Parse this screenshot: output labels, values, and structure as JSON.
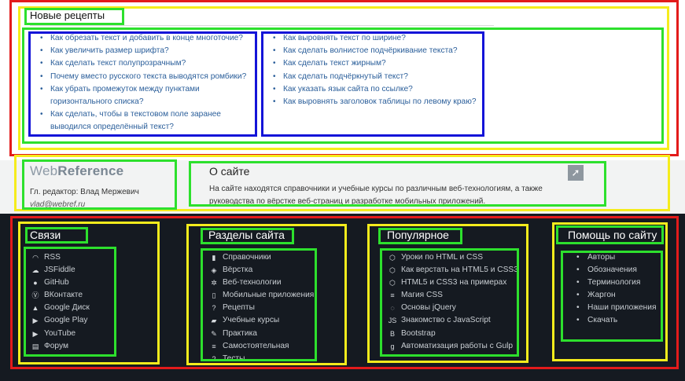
{
  "recipes": {
    "title": "Новые рецепты",
    "left": [
      "Как обрезать текст и добавить в конце многоточие?",
      "Как увеличить размер шрифта?",
      "Как сделать текст полупрозрачным?",
      "Почему вместо русского текста выводятся ромбики?",
      "Как убрать промежуток между пунктами горизонтального списка?",
      "Как сделать, чтобы в текстовом поле заранее выводился определённый текст?"
    ],
    "right": [
      "Как выровнять текст по ширине?",
      "Как сделать волнистое подчёркивание текста?",
      "Как сделать текст жирным?",
      "Как сделать подчёркнутый текст?",
      "Как указать язык сайта по ссылке?",
      "Как выровнять заголовок таблицы по левому краю?"
    ]
  },
  "brand": {
    "logo_light": "Web",
    "logo_bold": "Reference",
    "editor": "Гл. редактор: Влад Мержевич",
    "email": "vlad@webref.ru"
  },
  "about": {
    "title": "О сайте",
    "text": "На сайте находятся справочники и учебные курсы по различным веб-технологиям, а также руководства по вёрстке веб-страниц и разработке мобильных приложений.",
    "arrow": "➚"
  },
  "footer": {
    "links_title": "Связи",
    "links": [
      {
        "label": "RSS",
        "icon": "rss-icon",
        "glyph": "◠"
      },
      {
        "label": "JSFiddle",
        "icon": "jsfiddle-icon",
        "glyph": "☁"
      },
      {
        "label": "GitHub",
        "icon": "github-icon",
        "glyph": "●"
      },
      {
        "label": "ВКонтакте",
        "icon": "vk-icon",
        "glyph": "Ⓥ"
      },
      {
        "label": "Google Диск",
        "icon": "google-drive-icon",
        "glyph": "▲"
      },
      {
        "label": "Google Play",
        "icon": "google-play-icon",
        "glyph": "▶"
      },
      {
        "label": "YouTube",
        "icon": "youtube-icon",
        "glyph": "▶"
      },
      {
        "label": "Форум",
        "icon": "forum-icon",
        "glyph": "▤"
      }
    ],
    "sections_title": "Разделы сайта",
    "sections": [
      {
        "label": "Справочники",
        "icon": "book-icon",
        "glyph": "▮"
      },
      {
        "label": "Вёрстка",
        "icon": "layers-icon",
        "glyph": "◈"
      },
      {
        "label": "Веб-технологии",
        "icon": "gears-icon",
        "glyph": "✲"
      },
      {
        "label": "Мобильные приложения",
        "icon": "mobile-icon",
        "glyph": "▯"
      },
      {
        "label": "Рецепты",
        "icon": "question-icon",
        "glyph": "?"
      },
      {
        "label": "Учебные курсы",
        "icon": "graduation-cap-icon",
        "glyph": "▰"
      },
      {
        "label": "Практика",
        "icon": "pencil-icon",
        "glyph": "✎"
      },
      {
        "label": "Самостоятельная",
        "icon": "css3-icon",
        "glyph": "≡"
      },
      {
        "label": "Тесты",
        "icon": "question-icon",
        "glyph": "?"
      }
    ],
    "popular_title": "Популярное",
    "popular": [
      {
        "label": "Уроки по HTML и CSS",
        "icon": "html5-icon",
        "glyph": "⬡"
      },
      {
        "label": "Как верстать на HTML5 и CSS3",
        "icon": "html5-icon",
        "glyph": "⬡"
      },
      {
        "label": "HTML5 и CSS3 на примерах",
        "icon": "html5-icon",
        "glyph": "⬡"
      },
      {
        "label": "Магия CSS",
        "icon": "css3-icon",
        "glyph": "≡"
      },
      {
        "label": "Основы jQuery",
        "icon": "jquery-icon",
        "glyph": "◌"
      },
      {
        "label": "Знакомство с JavaScript",
        "icon": "javascript-icon",
        "glyph": "JS"
      },
      {
        "label": "Bootstrap",
        "icon": "bootstrap-icon",
        "glyph": "B"
      },
      {
        "label": "Автоматизация работы с Gulp",
        "icon": "gulp-icon",
        "glyph": "ɡ"
      }
    ],
    "help_title": "Помощь по сайту",
    "help": [
      "Авторы",
      "Обозначения",
      "Терминология",
      "Жаргон",
      "Наши приложения",
      "Скачать"
    ]
  }
}
